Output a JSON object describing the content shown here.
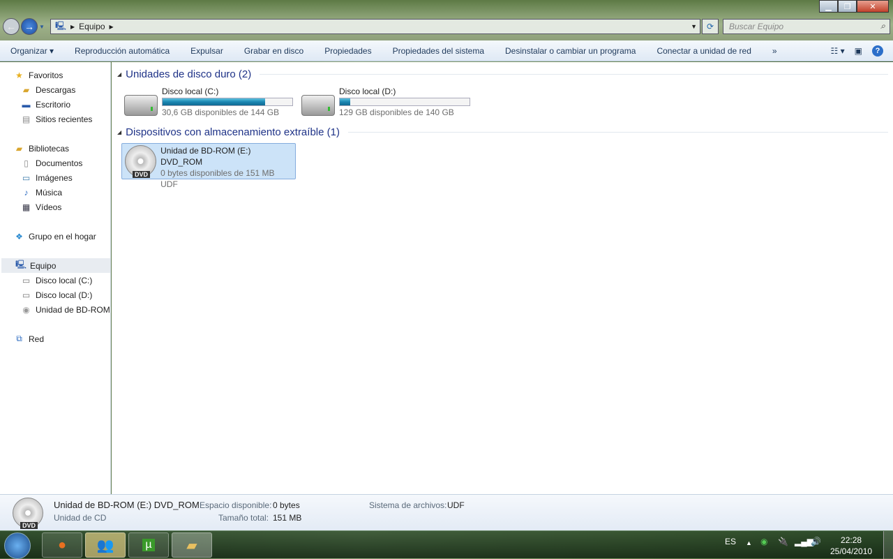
{
  "window": {
    "address": [
      "Equipo"
    ],
    "search_placeholder": "Buscar Equipo"
  },
  "toolbar": {
    "items": [
      "Organizar ▾",
      "Reproducción automática",
      "Expulsar",
      "Grabar en disco",
      "Propiedades",
      "Propiedades del sistema",
      "Desinstalar o cambiar un programa",
      "Conectar a unidad de red",
      "»"
    ]
  },
  "sidebar": {
    "favorites": {
      "label": "Favoritos",
      "items": [
        "Descargas",
        "Escritorio",
        "Sitios recientes"
      ]
    },
    "libraries": {
      "label": "Bibliotecas",
      "items": [
        "Documentos",
        "Imágenes",
        "Música",
        "Vídeos"
      ]
    },
    "homegroup": "Grupo en el hogar",
    "computer": {
      "label": "Equipo",
      "items": [
        "Disco local (C:)",
        "Disco local (D:)",
        "Unidad de BD-ROM"
      ]
    },
    "network": "Red"
  },
  "main": {
    "hdd_group": "Unidades de disco duro (2)",
    "drives": [
      {
        "name": "Disco local (C:)",
        "info": "30,6 GB disponibles de 144 GB",
        "used_fraction": 0.79
      },
      {
        "name": "Disco local (D:)",
        "info": "129 GB disponibles de 140 GB",
        "used_fraction": 0.08
      }
    ],
    "removable_group": "Dispositivos con almacenamiento extraíble (1)",
    "dvd": {
      "name": "Unidad de BD-ROM (E:) DVD_ROM",
      "info": "0 bytes disponibles de 151 MB",
      "fs": "UDF",
      "badge": "DVD"
    }
  },
  "details": {
    "name": "Unidad de BD-ROM (E:) DVD_ROM",
    "type": "Unidad de CD",
    "free_label": "Espacio disponible:",
    "free": "0 bytes",
    "total_label": "Tamaño total:",
    "total": "151 MB",
    "fs_label": "Sistema de archivos:",
    "fs": "UDF",
    "badge": "DVD"
  },
  "taskbar": {
    "lang": "ES",
    "time": "22:28",
    "date": "25/04/2010"
  }
}
